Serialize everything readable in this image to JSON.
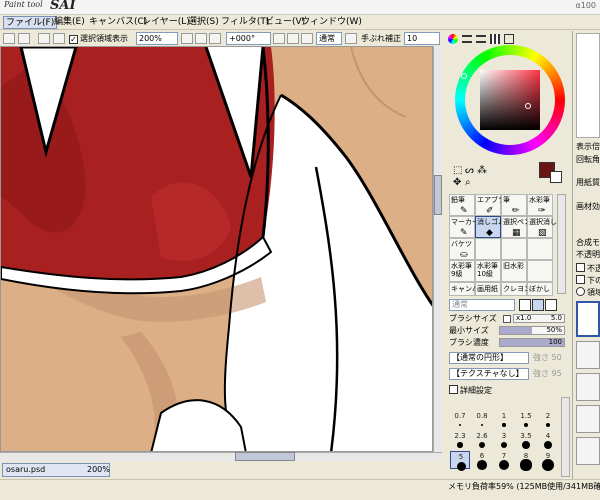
{
  "app": {
    "logo_small": "Paint tool",
    "logo_big": "SAI",
    "version": "α100"
  },
  "menu": [
    "ファイル(F)",
    "編集(E)",
    "キャンバス(C)",
    "レイヤー(L)",
    "選択(S)",
    "フィルタ(T)",
    "ビュー(V)",
    "ウィンドウ(W)"
  ],
  "toolbar": {
    "show_selection_label": "選択領域表示",
    "show_selection_checked": "✓",
    "zoom": "200%",
    "rotation": "+000°",
    "blend": "通常",
    "stabilizer_label": "手ぶれ補正",
    "stabilizer_value": "10"
  },
  "file_tab": {
    "name": "osaru.psd",
    "zoom": "200%"
  },
  "status": "メモリ負荷率59% (125MB使用/341MB確保)",
  "colors": {
    "current_fg": "#6b1414",
    "current_bg": "#ffffff",
    "sv_hue": "#ff3344"
  },
  "tools": [
    [
      "鉛筆",
      "エアブラシ",
      "筆",
      "水彩筆"
    ],
    [
      "マーカー",
      "消しゴム",
      "選択ペン",
      "選択消し"
    ],
    [
      "バケツ",
      "",
      "",
      ""
    ],
    [
      "水彩筆9級",
      "水彩筆10級",
      "旧水彩",
      ""
    ],
    [
      "キャンバス",
      "画用紙",
      "クレヨン",
      "ぼかし"
    ]
  ],
  "brush": {
    "blend_mode": "通常",
    "size_label": "ブラシサイズ",
    "size_mult": "x1.0",
    "size_value": "5.0",
    "min_size_label": "最小サイズ",
    "min_size_value": "50%",
    "min_size_fraction": 0.5,
    "density_label": "ブラシ濃度",
    "density_value": "100",
    "density_fraction": 1.0,
    "shape": "【通常の円形】",
    "shape_value": "強さ 50",
    "texture": "【テクスチャなし】",
    "texture_value": "強さ 95",
    "detail_label": "詳細設定"
  },
  "brush_sizes": [
    "0.7",
    "0.8",
    "1",
    "1.5",
    "2",
    "2.3",
    "2.6",
    "3",
    "3.5",
    "4",
    "5",
    "6",
    "7",
    "8",
    "9"
  ],
  "right_panel": {
    "items": [
      "表示倍",
      "回転角",
      "用紙質",
      "画材効",
      "合成モ",
      "不透明",
      "不透",
      "下の",
      "領域"
    ]
  }
}
